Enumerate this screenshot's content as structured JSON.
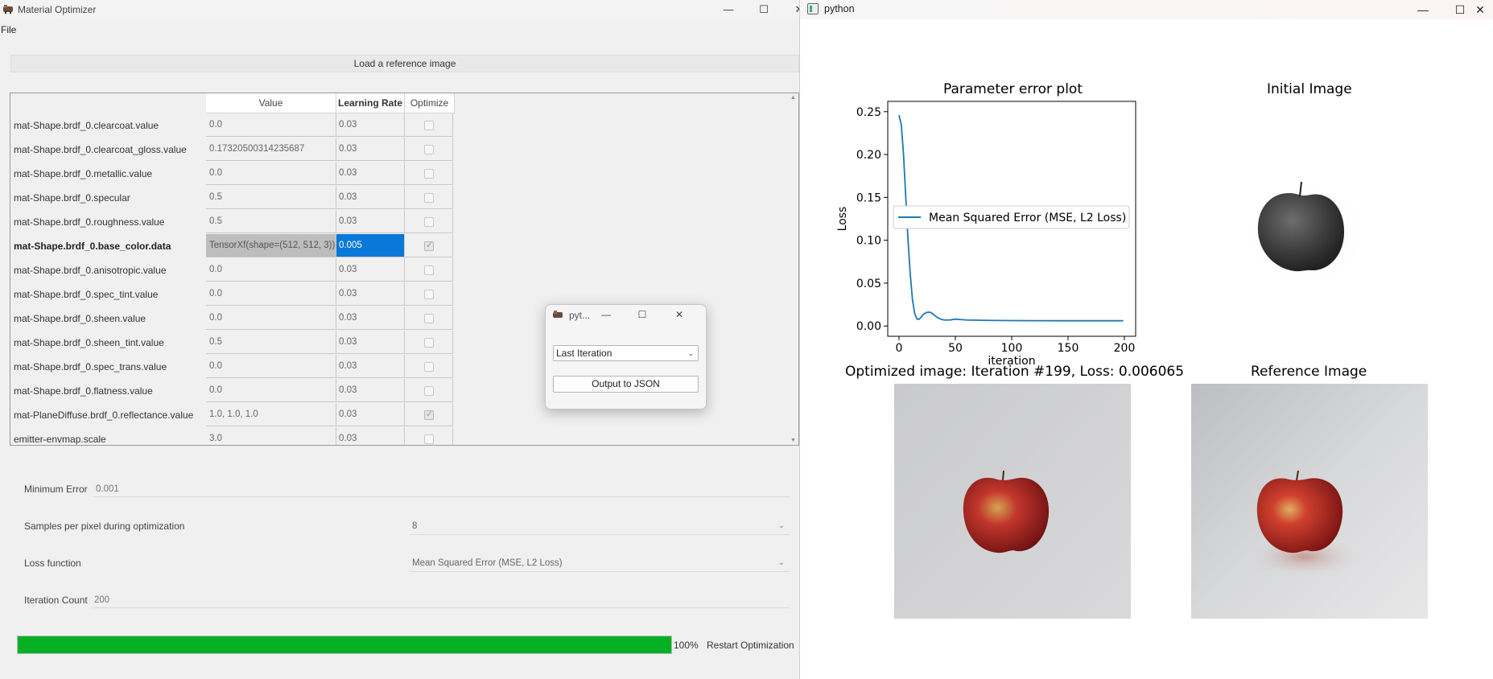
{
  "left_window": {
    "title": "Material Optimizer",
    "controls": {
      "minimize": "—",
      "maximize": "☐",
      "close": "✕"
    },
    "menu": {
      "file": "File"
    },
    "load_button": "Load a reference image",
    "table": {
      "headers": {
        "value": "Value",
        "learning_rate": "Learning Rate",
        "optimize": "Optimize"
      },
      "rows": [
        {
          "name": "mat-Shape.brdf_0.clearcoat.value",
          "value": "0.0",
          "lr": "0.03",
          "optimize": false
        },
        {
          "name": "mat-Shape.brdf_0.clearcoat_gloss.value",
          "value": "0.17320500314235687",
          "lr": "0.03",
          "optimize": false
        },
        {
          "name": "mat-Shape.brdf_0.metallic.value",
          "value": "0.0",
          "lr": "0.03",
          "optimize": false
        },
        {
          "name": "mat-Shape.brdf_0.specular",
          "value": "0.5",
          "lr": "0.03",
          "optimize": false
        },
        {
          "name": "mat-Shape.brdf_0.roughness.value",
          "value": "0.5",
          "lr": "0.03",
          "optimize": false
        },
        {
          "name": "mat-Shape.brdf_0.base_color.data",
          "value": "TensorXf(shape=(512, 512, 3))",
          "lr": "0.005",
          "optimize": true,
          "selected": true
        },
        {
          "name": "mat-Shape.brdf_0.anisotropic.value",
          "value": "0.0",
          "lr": "0.03",
          "optimize": false
        },
        {
          "name": "mat-Shape.brdf_0.spec_tint.value",
          "value": "0.0",
          "lr": "0.03",
          "optimize": false
        },
        {
          "name": "mat-Shape.brdf_0.sheen.value",
          "value": "0.0",
          "lr": "0.03",
          "optimize": false
        },
        {
          "name": "mat-Shape.brdf_0.sheen_tint.value",
          "value": "0.5",
          "lr": "0.03",
          "optimize": false
        },
        {
          "name": "mat-Shape.brdf_0.spec_trans.value",
          "value": "0.0",
          "lr": "0.03",
          "optimize": false
        },
        {
          "name": "mat-Shape.brdf_0.flatness.value",
          "value": "0.0",
          "lr": "0.03",
          "optimize": false
        },
        {
          "name": "mat-PlaneDiffuse.brdf_0.reflectance.value",
          "value": "1.0, 1.0, 1.0",
          "lr": "0.03",
          "optimize": true
        },
        {
          "name": "emitter-envmap.scale",
          "value": "3.0",
          "lr": "0.03",
          "optimize": false
        }
      ]
    },
    "min_error": {
      "label": "Minimum Error",
      "value": "0.001"
    },
    "spp": {
      "label": "Samples per pixel during optimization",
      "value": "8"
    },
    "loss_fn": {
      "label": "Loss function",
      "value": "Mean Squared Error (MSE, L2 Loss)"
    },
    "iteration_count": {
      "label": "Iteration Count",
      "value": "200"
    },
    "progress": {
      "value": 1.0,
      "text": "100%"
    },
    "restart_button": "Restart Optimization"
  },
  "popup": {
    "title": "pyt...",
    "select_value": "Last Iteration",
    "output_button": "Output to JSON"
  },
  "right_window": {
    "title": "python",
    "plot_title": "Parameter error plot",
    "initial_title": "Initial Image",
    "optimized_title": "Optimized image: Iteration #199, Loss: 0.006065",
    "reference_title": "Reference Image"
  },
  "chart_data": {
    "type": "line",
    "title": "Parameter error plot",
    "xlabel": "iteration",
    "ylabel": "Loss",
    "xlim": [
      -10,
      210
    ],
    "ylim": [
      -0.012,
      0.262
    ],
    "xticks": [
      0,
      50,
      100,
      150,
      200
    ],
    "yticks": [
      0.0,
      0.05,
      0.1,
      0.15,
      0.2,
      0.25
    ],
    "ytick_labels": [
      "0.00",
      "0.05",
      "0.10",
      "0.15",
      "0.20",
      "0.25"
    ],
    "legend_position": "center-left",
    "color": "#1f77b4",
    "series": [
      {
        "name": "Mean Squared Error (MSE, L2 Loss)",
        "x": [
          0,
          2,
          4,
          6,
          8,
          10,
          12,
          14,
          16,
          18,
          20,
          22,
          25,
          28,
          31,
          34,
          37,
          40,
          45,
          50,
          55,
          60,
          70,
          80,
          100,
          120,
          150,
          180,
          199
        ],
        "y": [
          0.246,
          0.235,
          0.2,
          0.15,
          0.1,
          0.06,
          0.03,
          0.014,
          0.008,
          0.008,
          0.011,
          0.014,
          0.016,
          0.016,
          0.013,
          0.01,
          0.008,
          0.007,
          0.007,
          0.008,
          0.0075,
          0.007,
          0.0068,
          0.0065,
          0.0063,
          0.0062,
          0.0061,
          0.0061,
          0.0061
        ]
      }
    ]
  }
}
